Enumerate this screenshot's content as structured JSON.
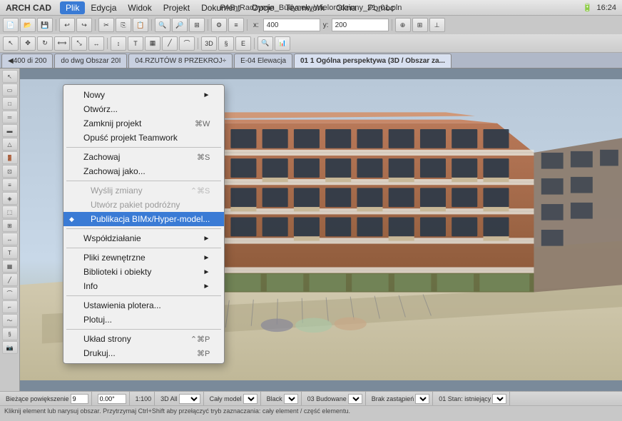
{
  "app": {
    "name": "ARCHICAD",
    "title": "ARCH CAD"
  },
  "menubar": {
    "items": [
      "Plik",
      "Edycja",
      "Widok",
      "Projekt",
      "Dokument",
      "Opcje",
      "Teamwork",
      "Okna",
      "Pomoc"
    ],
    "active_item": "Plik",
    "filename": "PAB_Radzymin_Budynek_Wielorodzinny_21_01.pln",
    "time": "16:24",
    "battery": "100%"
  },
  "dropdown": {
    "items": [
      {
        "label": "Nowy",
        "shortcut": "►",
        "icon": "",
        "type": "arrow"
      },
      {
        "label": "Otwórz...",
        "shortcut": "",
        "icon": "",
        "type": "normal"
      },
      {
        "label": "Zamknij projekt",
        "shortcut": "⌘W",
        "icon": "",
        "type": "normal"
      },
      {
        "label": "Opuść projekt Teamwork",
        "shortcut": "",
        "icon": "",
        "type": "normal"
      },
      {
        "label": "sep1",
        "type": "separator"
      },
      {
        "label": "Zachowaj",
        "shortcut": "⌘S",
        "icon": "",
        "type": "normal"
      },
      {
        "label": "Zachowaj jako...",
        "shortcut": "",
        "icon": "",
        "type": "normal"
      },
      {
        "label": "sep2",
        "type": "separator"
      },
      {
        "label": "Wyślij zmiany",
        "shortcut": "⌃⌘S",
        "icon": "",
        "type": "grayed"
      },
      {
        "label": "Utwórz pakiet podróżny",
        "shortcut": "",
        "icon": "",
        "type": "grayed"
      },
      {
        "label": "Publikacja BIMx/Hyper-model...",
        "shortcut": "",
        "icon": "◆",
        "type": "highlighted"
      },
      {
        "label": "sep3",
        "type": "separator"
      },
      {
        "label": "Współdziałanie",
        "shortcut": "►",
        "icon": "",
        "type": "arrow"
      },
      {
        "label": "sep4",
        "type": "separator"
      },
      {
        "label": "Pliki zewnętrzne",
        "shortcut": "►",
        "icon": "",
        "type": "arrow"
      },
      {
        "label": "Biblioteki i obiekty",
        "shortcut": "►",
        "icon": "",
        "type": "arrow"
      },
      {
        "label": "Info",
        "shortcut": "►",
        "icon": "",
        "type": "arrow"
      },
      {
        "label": "sep5",
        "type": "separator"
      },
      {
        "label": "Ustawienia plotera...",
        "shortcut": "",
        "icon": "🖨",
        "type": "normal"
      },
      {
        "label": "Plotuj...",
        "shortcut": "",
        "icon": "",
        "type": "normal"
      },
      {
        "label": "sep6",
        "type": "separator"
      },
      {
        "label": "Układ strony",
        "shortcut": "⌃⌘P",
        "icon": "",
        "type": "normal"
      },
      {
        "label": "Drukuj...",
        "shortcut": "⌘P",
        "icon": "",
        "type": "normal"
      }
    ]
  },
  "tabs": [
    {
      "label": "◀400 di 200"
    },
    {
      "label": "do dwg Obszar 20I"
    },
    {
      "label": "04.RZUTÓW 8 PRZEKROJ÷"
    },
    {
      "label": "E-04 Elewacja"
    },
    {
      "label": "01 1 Ogólna perspektywa (3D / Obszar za..."
    }
  ],
  "bottom_bar": {
    "zoom": "Bieżące powiększenie",
    "zoom_value": "9",
    "coord1": "0.00°",
    "scale": "1:100",
    "view_mode": "3D All",
    "display": "Cały model",
    "pen": "Black",
    "layer": "03 Budowane",
    "replace": "Brak zastąpień",
    "status": "01 Stan: istniejący"
  },
  "status_bar": {
    "text": "Kliknij element lub narysuj obszar. Przytrzymaj Ctrl+Shift aby przełączyć tryb zaznaczania: cały element / część elementu."
  },
  "left_tools": [
    "arrow",
    "pen",
    "wall",
    "door",
    "window",
    "slab",
    "roof",
    "stair",
    "column",
    "beam",
    "mesh",
    "zone",
    "curtain",
    "object",
    "lamp",
    "camera"
  ]
}
